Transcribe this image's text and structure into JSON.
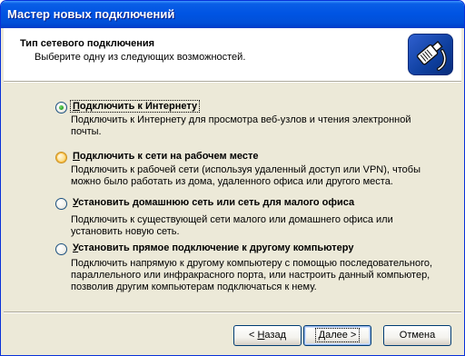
{
  "window": {
    "title": "Мастер новых подключений"
  },
  "header": {
    "title": "Тип сетевого подключения",
    "subtitle": "Выберите одну из следующих возможностей.",
    "icon": "network-cable-icon"
  },
  "options": [
    {
      "label_accel": "П",
      "label_rest": "одключить к Интернету",
      "desc_lines": [
        "Подключить к Интернету для просмотра веб-узлов и чтения  электронной",
        "почты."
      ],
      "selected": true
    },
    {
      "label_accel": "П",
      "label_rest": "одключить к сети на рабочем месте",
      "desc_lines": [
        "Подключить к рабочей сети (используя удаленный доступ или VPN), чтобы",
        "можно было работать из дома, удаленного офиса или другого места."
      ],
      "selected": false
    },
    {
      "label_accel": "У",
      "label_rest": "становить домашнюю сеть или сеть для малого офиса",
      "desc_lines": [
        "Подключить к существующей сети малого или домашнего офиса или",
        "установить новую сеть."
      ],
      "selected": false
    },
    {
      "label_accel": "У",
      "label_rest": "становить прямое подключение к другому компьютеру",
      "desc_lines": [
        "Подключить напрямую к другому компьютеру с помощью последовательного,",
        "параллельного или инфракрасного порта, или настроить данный компьютер,",
        "позволив другим  компьютерам подключаться к нему."
      ],
      "selected": false
    }
  ],
  "buttons": {
    "back_prefix": "< ",
    "back_accel": "Н",
    "back_rest": "азад",
    "next_accel": "Д",
    "next_rest": "алее >",
    "cancel": "Отмена"
  }
}
